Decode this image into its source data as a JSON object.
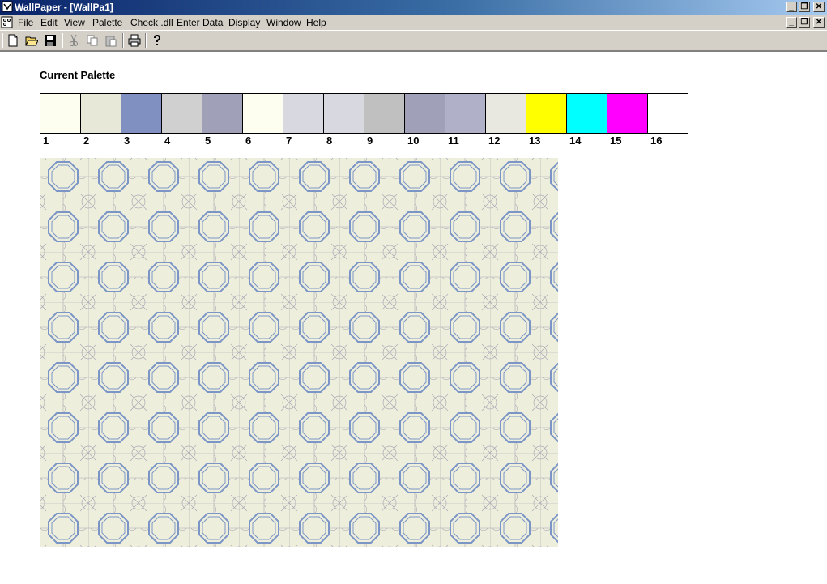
{
  "window": {
    "title": "WallPaper - [WallPa1]"
  },
  "menu": {
    "items": [
      "File",
      "Edit",
      "View",
      "Palette",
      "Check .dll",
      "Enter Data",
      "Display",
      "Window",
      "Help"
    ]
  },
  "toolbar": {
    "buttons": [
      "new-icon",
      "open-icon",
      "save-icon",
      "cut-icon",
      "copy-icon",
      "paste-icon",
      "print-icon",
      "help-icon"
    ]
  },
  "palette": {
    "heading": "Current Palette",
    "swatches": [
      {
        "label": "1",
        "color": "#fefef0"
      },
      {
        "label": "2",
        "color": "#e8e8d8"
      },
      {
        "label": "3",
        "color": "#8090c0"
      },
      {
        "label": "4",
        "color": "#d0d0d0"
      },
      {
        "label": "5",
        "color": "#a0a0b8"
      },
      {
        "label": "6",
        "color": "#fefef0"
      },
      {
        "label": "7",
        "color": "#d8d8e0"
      },
      {
        "label": "8",
        "color": "#d8d8e0"
      },
      {
        "label": "9",
        "color": "#c0c0c0"
      },
      {
        "label": "10",
        "color": "#a0a0b8"
      },
      {
        "label": "11",
        "color": "#b0b0c8"
      },
      {
        "label": "12",
        "color": "#e8e8e0"
      },
      {
        "label": "13",
        "color": "#ffff00"
      },
      {
        "label": "14",
        "color": "#00ffff"
      },
      {
        "label": "15",
        "color": "#ff00ff"
      },
      {
        "label": "16",
        "color": "#ffffff"
      }
    ]
  },
  "pattern": {
    "background": "#eeeedd",
    "octagon_color": "#7b95c6",
    "grid_color": "#a9a9b4"
  }
}
